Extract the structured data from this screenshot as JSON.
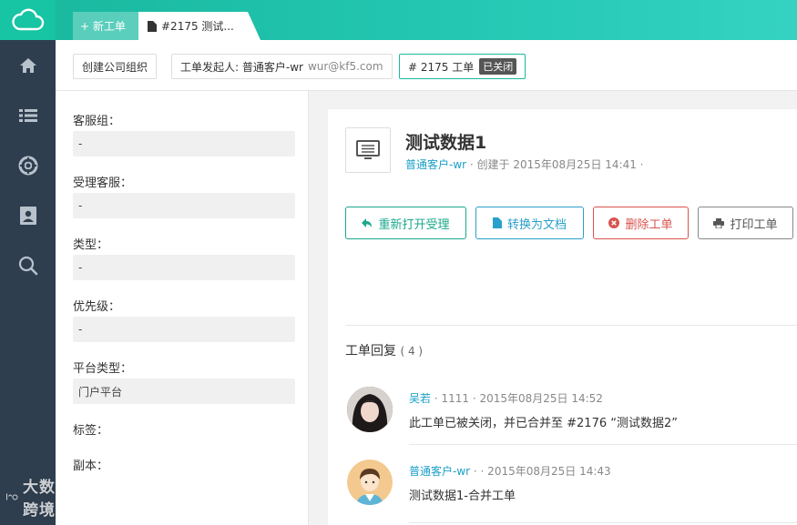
{
  "brand": {
    "logo": "cloud-icon",
    "accent": "#19b99f"
  },
  "nav": {
    "items": [
      "home-icon",
      "list-icon",
      "lifebuoy-icon",
      "contacts-icon",
      "search-icon"
    ]
  },
  "tabs": {
    "new_label": "+ 新工单",
    "active_label": "#2175 测试..."
  },
  "breadcrumb": {
    "org_label": "创建公司组织",
    "requester_label": "工单发起人: 普通客户-wr",
    "requester_email": "wur@kf5.com",
    "ticket_label": "# 2175 工单",
    "status": "已关闭"
  },
  "props": {
    "group": {
      "label": "客服组：",
      "value": "-"
    },
    "agent": {
      "label": "受理客服：",
      "value": "-"
    },
    "type": {
      "label": "类型：",
      "value": "-"
    },
    "priority": {
      "label": "优先级：",
      "value": "-"
    },
    "platform": {
      "label": "平台类型：",
      "value": "门户平台"
    },
    "tags": {
      "label": "标签："
    },
    "cc": {
      "label": "副本："
    }
  },
  "ticket": {
    "title": "测试数据1",
    "author": "普通客户-wr",
    "created": "· 创建于 2015年08月25日 14:41 ·"
  },
  "actions": {
    "reopen": "重新打开受理",
    "convert": "转换为文档",
    "delete": "删除工单",
    "print": "打印工单"
  },
  "replies": {
    "heading": "工单回复",
    "count": "( 4 )",
    "items": [
      {
        "author": "吴若",
        "meta": "· 1111 · 2015年08月25日 14:52",
        "body": "此工单已被关闭，并已合并至 #2176 “测试数据2”"
      },
      {
        "author": "普通客户-wr",
        "meta": "· · 2015年08月25日 14:43",
        "body": "测试数据1-合并工单"
      }
    ]
  },
  "watermark": {
    "text": "大数跨境"
  }
}
